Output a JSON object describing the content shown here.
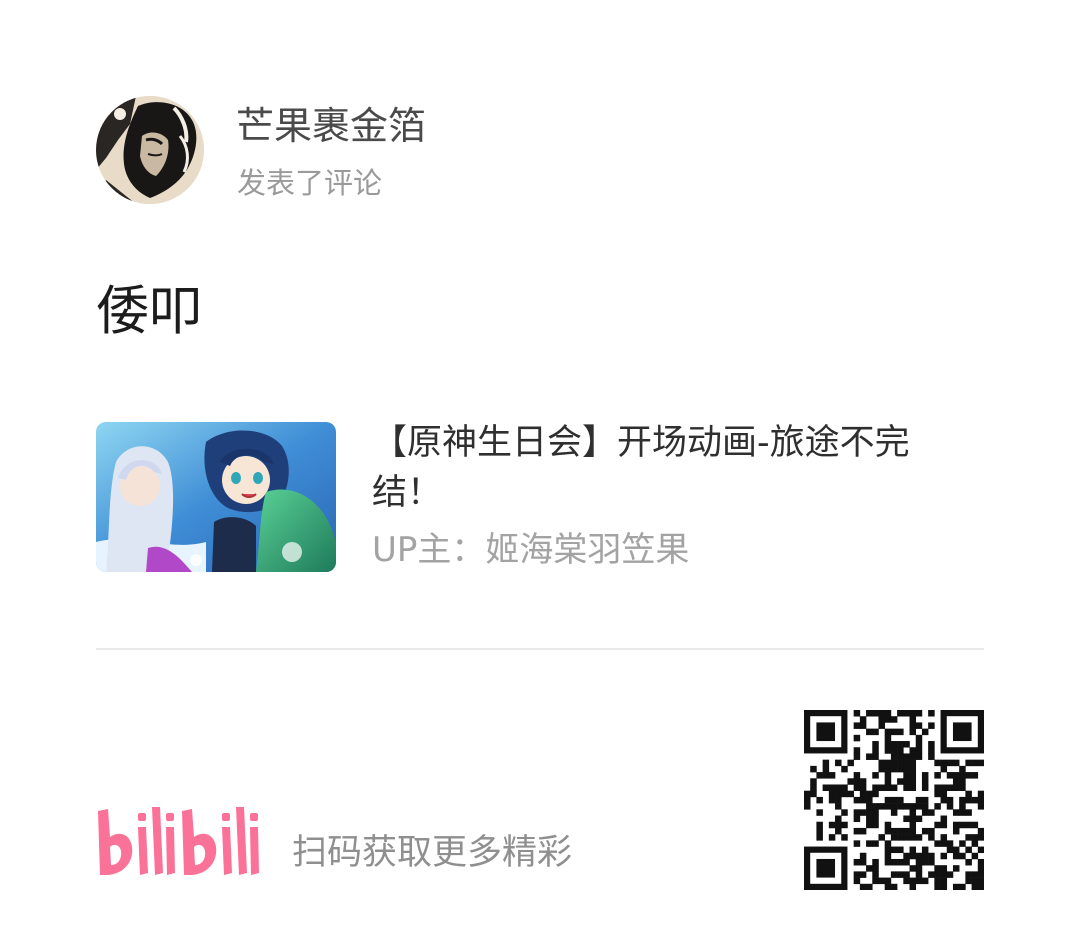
{
  "user": {
    "name": "芒果裹金箔",
    "action": "发表了评论"
  },
  "comment": {
    "text": "倭叩"
  },
  "video": {
    "title": "【原神生日会】开场动画-旅途不完结！",
    "uploader": "UP主：姬海棠羽笠果"
  },
  "footer": {
    "logo_text": "bilibili",
    "scan_text": "扫码获取更多精彩"
  },
  "colors": {
    "brand_pink": "#fb7299",
    "text_dark": "#1c1c1c",
    "text_gray": "#9a9a9a"
  },
  "icons": [
    "avatar-image",
    "video-thumbnail",
    "bilibili-logo",
    "qr-code"
  ]
}
